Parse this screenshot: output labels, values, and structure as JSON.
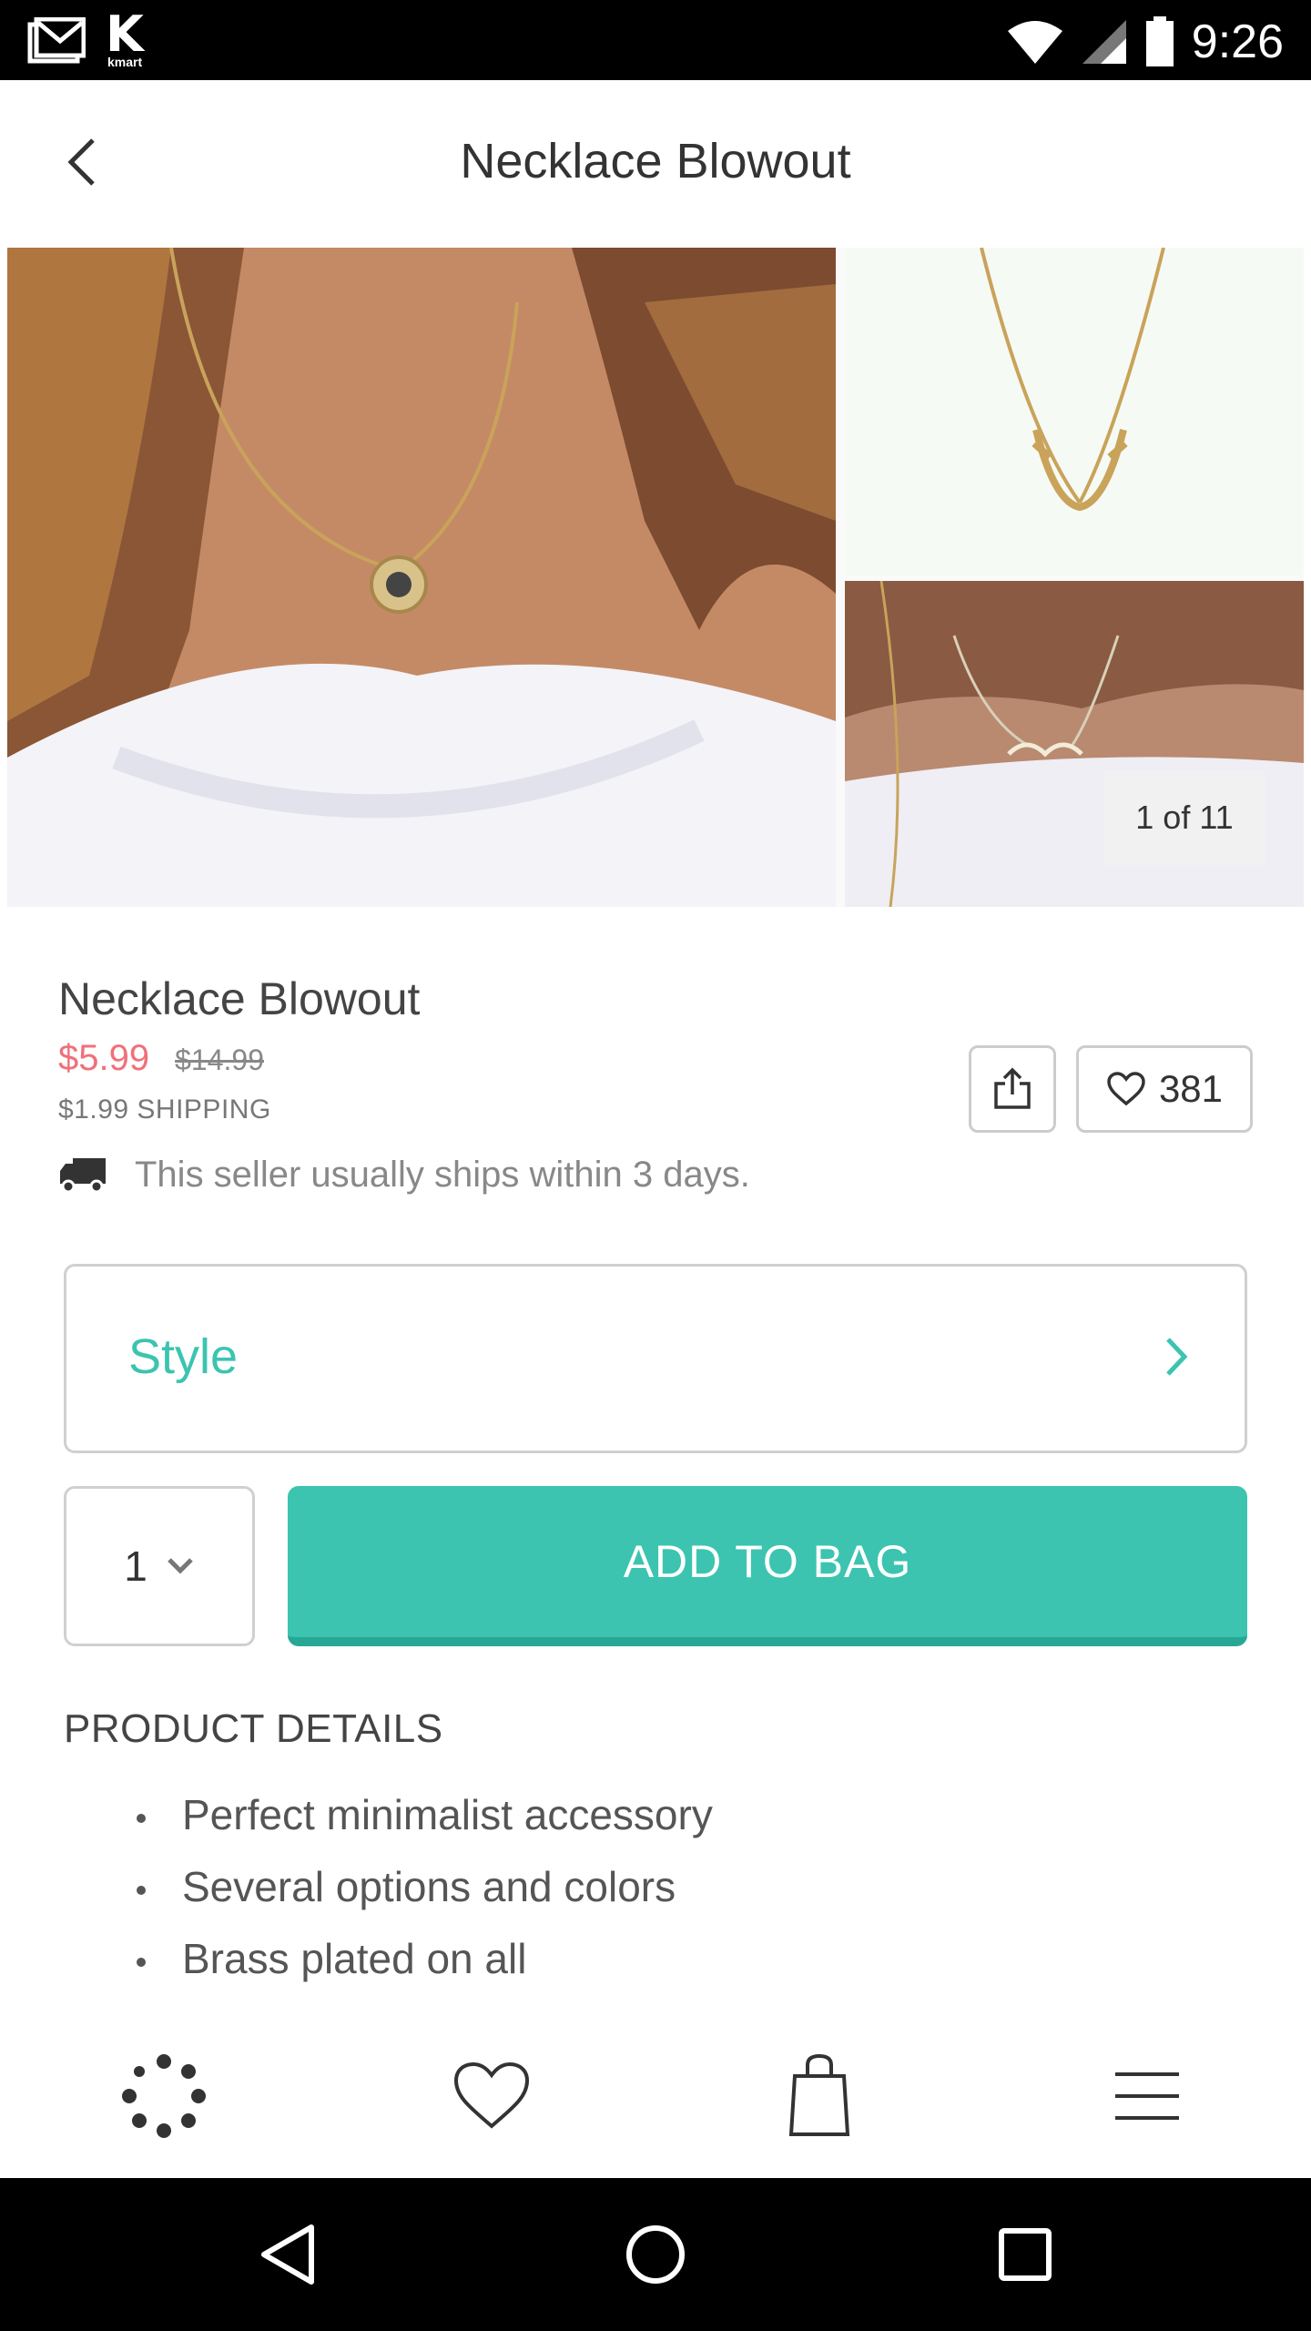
{
  "status_bar": {
    "time": "9:26",
    "icons": [
      "gmail-icon",
      "kmart-icon",
      "wifi-icon",
      "signal-icon",
      "battery-icon"
    ],
    "kmart_wordmark": "kmart"
  },
  "app_bar": {
    "title": "Necklace Blowout",
    "back_icon": "back-arrow-icon"
  },
  "gallery": {
    "counter": "1 of 11"
  },
  "product": {
    "name": "Necklace Blowout",
    "price": "$5.99",
    "original_price": "$14.99",
    "shipping": "$1.99 SHIPPING",
    "wish_count": "381",
    "shipping_note": "This seller usually ships within 3 days."
  },
  "style_selector": {
    "label": "Style"
  },
  "purchase": {
    "quantity": "1",
    "add_to_bag_label": "ADD TO BAG"
  },
  "details": {
    "heading": "PRODUCT DETAILS",
    "items": [
      "Perfect minimalist accessory",
      "Several options and colors",
      "Brass plated on all"
    ]
  },
  "tab_bar": {
    "tabs": [
      "feed-icon",
      "heart-icon",
      "shopping-bag-icon",
      "menu-icon"
    ]
  },
  "nav_bar": {
    "buttons": [
      "back-triangle-icon",
      "home-circle-icon",
      "recents-square-icon"
    ]
  },
  "colors": {
    "accent": "#3cc4b0",
    "sale_price": "#f0707a",
    "status_bar": "#000000"
  }
}
